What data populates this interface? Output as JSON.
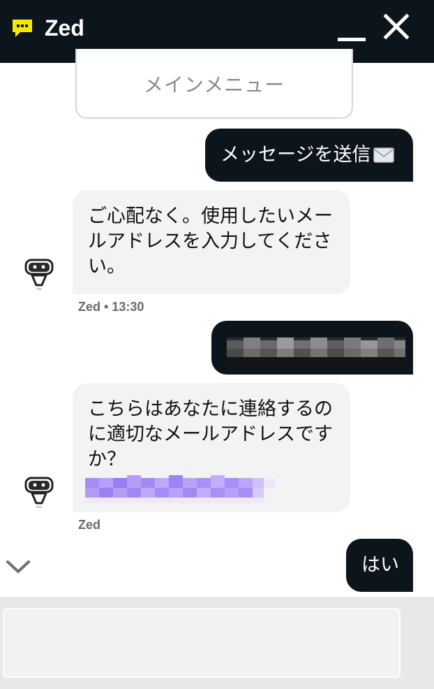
{
  "header": {
    "title": "Zed",
    "icon": "chat-bubble-icon",
    "accent_color": "#f4e900",
    "background": "#0d151c"
  },
  "menu_card": {
    "label": "メインメニュー"
  },
  "messages": [
    {
      "sender": "user",
      "text": "メッセージを送信"
    },
    {
      "sender": "bot",
      "text": "ご心配なく。使用したいメールアドレスを入力してください。",
      "meta": "Zed • 13:30"
    },
    {
      "sender": "user",
      "text": ""
    },
    {
      "sender": "bot",
      "text": "こちらはあなたに連絡するのに適切なメールアドレスですか？",
      "meta": "Zed"
    },
    {
      "sender": "user",
      "text": "はい"
    }
  ],
  "input": {
    "placeholder": "",
    "value": ""
  }
}
